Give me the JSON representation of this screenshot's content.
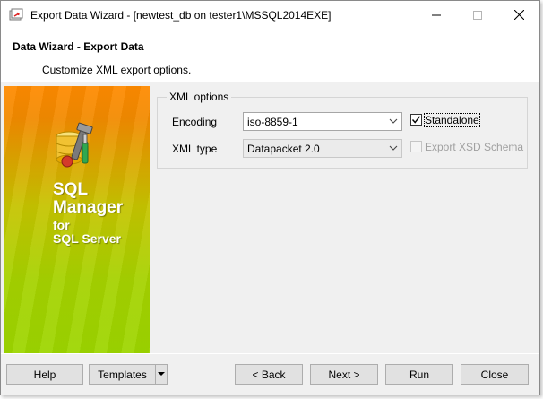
{
  "window": {
    "title": "Export Data Wizard - [newtest_db on tester1\\MSSQL2014EXE]"
  },
  "header": {
    "title": "Data Wizard - Export Data",
    "subtitle": "Customize XML export options."
  },
  "sidebar": {
    "brand_line1": "SQL",
    "brand_line2": "Manager",
    "brand_line3": "for",
    "brand_line4": "SQL Server",
    "icon": "database-tools-icon"
  },
  "xml_options": {
    "group_title": "XML options",
    "encoding_label": "Encoding",
    "encoding_value": "iso-8859-1",
    "xml_type_label": "XML type",
    "xml_type_value": "Datapacket 2.0",
    "standalone_label": "Standalone",
    "standalone_checked": true,
    "export_xsd_label": "Export XSD Schema",
    "export_xsd_checked": false,
    "export_xsd_enabled": false
  },
  "footer": {
    "help_label": "Help",
    "templates_label": "Templates",
    "back_label": "< Back",
    "next_label": "Next >",
    "run_label": "Run",
    "close_label": "Close"
  }
}
